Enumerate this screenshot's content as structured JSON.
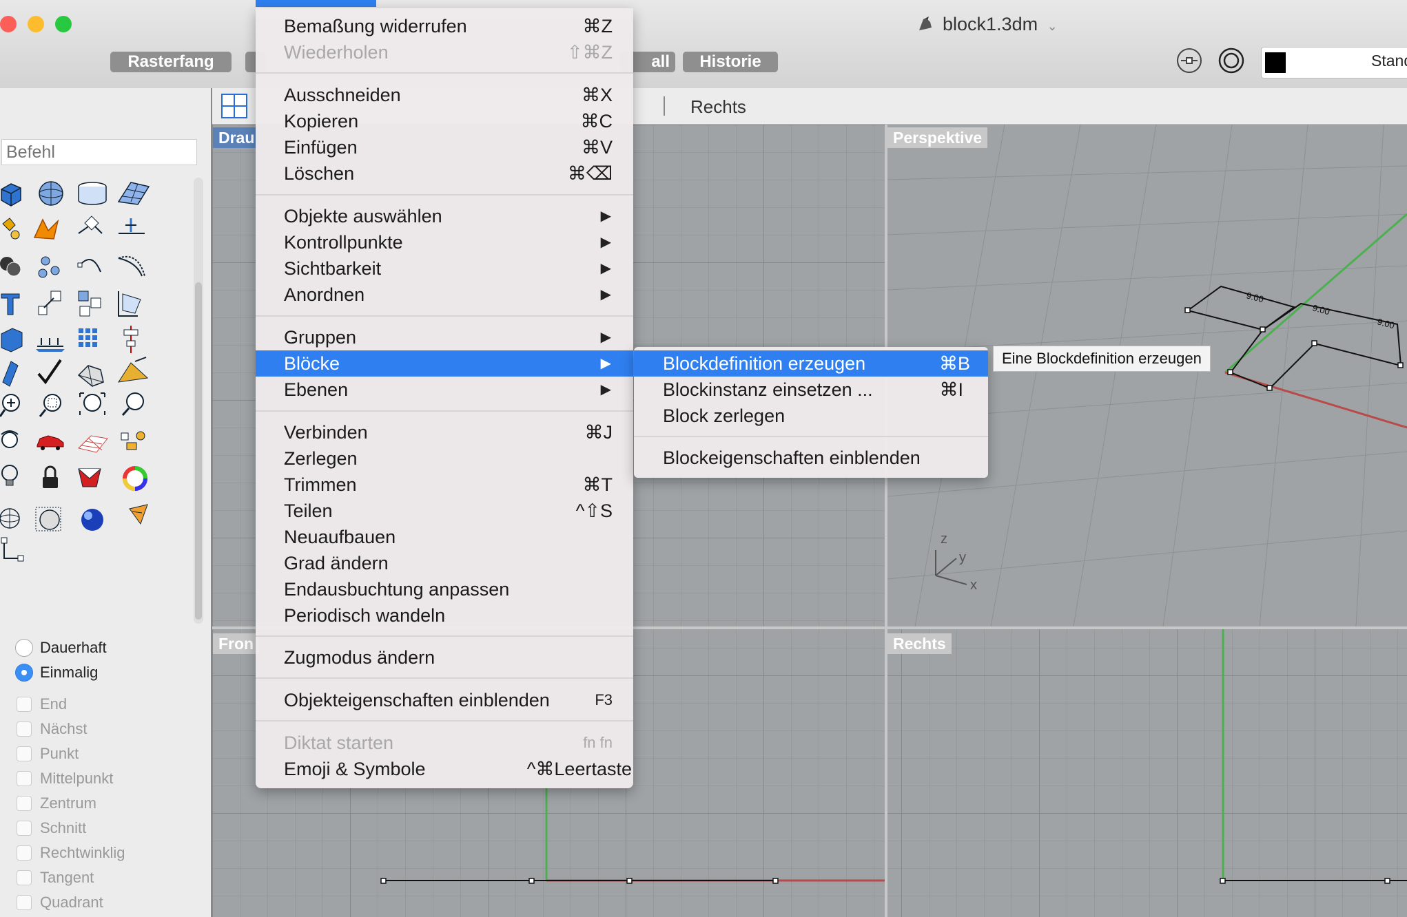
{
  "window": {
    "document_title": "block1.3dm",
    "toolbar_buttons": [
      "Rasterfang",
      "all",
      "Historie"
    ],
    "layer_name": "Stand",
    "layer_color": "#000000"
  },
  "view_tabs": {
    "right_tab": "Rechts"
  },
  "command": {
    "placeholder": "Befehl"
  },
  "viewports": {
    "top": "Drau",
    "perspective": "Perspektive",
    "front": "Fron",
    "right": "Rechts",
    "axis_labels": [
      "z",
      "y",
      "x"
    ],
    "dimension_labels": [
      "9.00",
      "9.00",
      "9.00"
    ]
  },
  "osnap": {
    "mode_options": [
      {
        "label": "Dauerhaft",
        "selected": false
      },
      {
        "label": "Einmalig",
        "selected": true
      }
    ],
    "snaps": [
      "End",
      "Nächst",
      "Punkt",
      "Mittelpunkt",
      "Zentrum",
      "Schnitt",
      "Rechtwinklig",
      "Tangent",
      "Quadrant"
    ]
  },
  "edit_menu": {
    "items": [
      {
        "label": "Bemaßung widerrufen",
        "shortcut": "⌘Z"
      },
      {
        "label": "Wiederholen",
        "shortcut": "⇧⌘Z",
        "disabled": true
      },
      {
        "label": "Ausschneiden",
        "shortcut": "⌘X"
      },
      {
        "label": "Kopieren",
        "shortcut": "⌘C"
      },
      {
        "label": "Einfügen",
        "shortcut": "⌘V"
      },
      {
        "label": "Löschen",
        "shortcut": "⌘⌫"
      },
      {
        "label": "Objekte auswählen",
        "submenu": true
      },
      {
        "label": "Kontrollpunkte",
        "submenu": true
      },
      {
        "label": "Sichtbarkeit",
        "submenu": true
      },
      {
        "label": "Anordnen",
        "submenu": true
      },
      {
        "label": "Gruppen",
        "submenu": true
      },
      {
        "label": "Blöcke",
        "submenu": true,
        "highlighted": true
      },
      {
        "label": "Ebenen",
        "submenu": true
      },
      {
        "label": "Verbinden",
        "shortcut": "⌘J"
      },
      {
        "label": "Zerlegen"
      },
      {
        "label": "Trimmen",
        "shortcut": "⌘T"
      },
      {
        "label": "Teilen",
        "shortcut": "^⇧S"
      },
      {
        "label": "Neuaufbauen"
      },
      {
        "label": "Grad ändern"
      },
      {
        "label": "Endausbuchtung anpassen"
      },
      {
        "label": "Periodisch wandeln"
      },
      {
        "label": "Zugmodus ändern"
      },
      {
        "label": "Objekteigenschaften einblenden",
        "shortcut": "F3"
      },
      {
        "label": "Diktat starten",
        "shortcut": "fn fn",
        "disabled": true
      },
      {
        "label": "Emoji & Symbole",
        "shortcut": "^⌘Leertaste"
      }
    ]
  },
  "blocks_submenu": {
    "items": [
      {
        "label": "Blockdefinition erzeugen",
        "shortcut": "⌘B",
        "highlighted": true
      },
      {
        "label": "Blockinstanz einsetzen ...",
        "shortcut": "⌘I"
      },
      {
        "label": "Block zerlegen"
      },
      {
        "label": "Blockeigenschaften einblenden"
      }
    ],
    "tooltip": "Eine Blockdefinition erzeugen"
  },
  "colors": {
    "menu_highlight": "#2f7ff0",
    "x_axis": "#b84a4a",
    "y_axis": "#4caf50",
    "viewport_bg": "#9fa3a6"
  }
}
